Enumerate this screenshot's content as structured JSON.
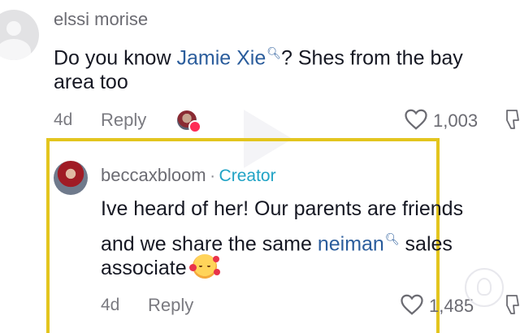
{
  "comment1": {
    "username": "elssi morise",
    "text_before": "Do you know ",
    "mention": "Jamie Xie",
    "text_after": "? Shes from the bay",
    "text_line2": "area too",
    "age": "4d",
    "reply_label": "Reply",
    "likes": "1,003"
  },
  "comment2": {
    "username": "beccaxbloom",
    "separator": "·",
    "creator_label": "Creator",
    "text_line1": "Ive heard of her! Our parents are friends",
    "text_line2_before": "and we share the same ",
    "mention": "neiman",
    "text_line2_after": " sales",
    "text_line3": "associate",
    "age": "4d",
    "reply_label": "Reply",
    "likes": "1,485"
  },
  "colors": {
    "highlight": "#e3c51e",
    "link": "#2b5d9c",
    "creator": "#20a3c5"
  },
  "icons": [
    "search-icon",
    "heart-outline-icon",
    "dislike-icon",
    "play-icon",
    "smiling-face-with-hearts-emoji",
    "watermark-icon"
  ]
}
